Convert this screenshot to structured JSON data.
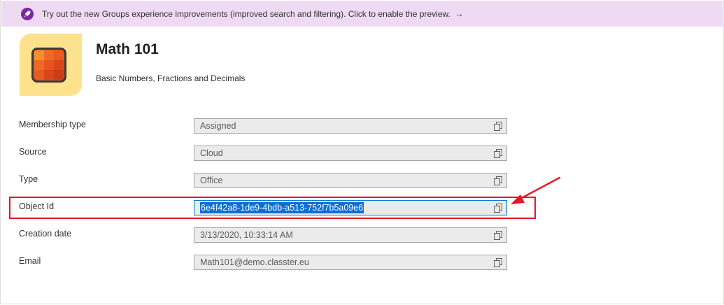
{
  "banner": {
    "text": "Try out the new Groups experience improvements (improved search and filtering). Click to enable the preview.",
    "arrow": "→",
    "icon": "rocket-icon",
    "background": "#efdaf3",
    "accent": "#7b2a9e"
  },
  "group": {
    "name": "Math 101",
    "description": "Basic Numbers, Fractions and Decimals",
    "logo_icon": "grid-tile-icon"
  },
  "properties": [
    {
      "label": "Membership type",
      "value": "Assigned"
    },
    {
      "label": "Source",
      "value": "Cloud"
    },
    {
      "label": "Type",
      "value": "Office"
    },
    {
      "label": "Object Id",
      "value": "6e4f42a8-1de9-4bdb-a513-752f7b5a09e6"
    },
    {
      "label": "Creation date",
      "value": "3/13/2020, 10:33:14 AM"
    },
    {
      "label": "Email",
      "value": "Math101@demo.classter.eu"
    }
  ],
  "copy_icon": "copy-icon",
  "annotation": {
    "highlight_color": "#e3172b",
    "highlighted_row": "Object Id"
  }
}
